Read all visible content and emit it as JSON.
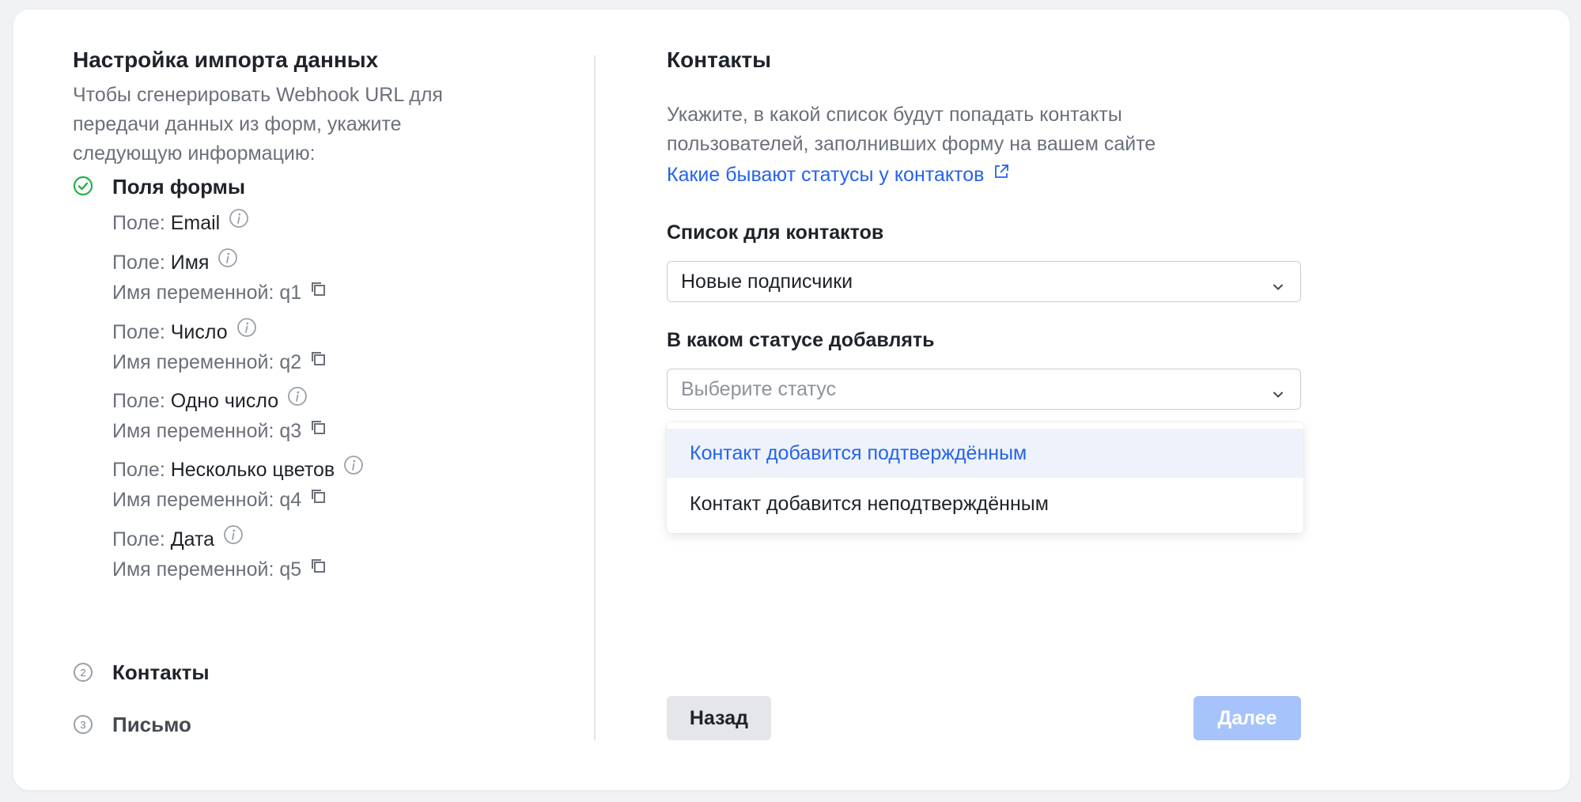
{
  "left": {
    "title": "Настройка импорта данных",
    "description": "Чтобы сгенерировать Webhook URL для передачи данных из форм, укажите следующую информацию:",
    "step1": {
      "title": "Поля формы",
      "fields": [
        {
          "prefix": "Поле:",
          "name": "Email",
          "var_label": "",
          "var": ""
        },
        {
          "prefix": "Поле:",
          "name": "Имя",
          "var_label": "Имя переменной:",
          "var": "q1"
        },
        {
          "prefix": "Поле:",
          "name": "Число",
          "var_label": "Имя переменной:",
          "var": "q2"
        },
        {
          "prefix": "Поле:",
          "name": "Одно число",
          "var_label": "Имя переменной:",
          "var": "q3"
        },
        {
          "prefix": "Поле:",
          "name": "Несколько цветов",
          "var_label": "Имя переменной:",
          "var": "q4"
        },
        {
          "prefix": "Поле:",
          "name": "Дата",
          "var_label": "Имя переменной:",
          "var": "q5"
        }
      ]
    },
    "step2": {
      "number": "2",
      "title": "Контакты"
    },
    "step3": {
      "number": "3",
      "title": "Письмо"
    }
  },
  "right": {
    "title": "Контакты",
    "description": "Укажите, в какой список будут попадать контакты пользователей, заполнивших форму на вашем сайте",
    "link": "Какие бывают статусы у контактов",
    "list_label": "Список для контактов",
    "list_value": "Новые подписчики",
    "status_label": "В каком статусе добавлять",
    "status_placeholder": "Выберите статус",
    "options": [
      "Контакт добавится подтверждённым",
      "Контакт добавится неподтверждённым"
    ],
    "back_label": "Назад",
    "next_label": "Далее"
  },
  "colors": {
    "accent": "#2563eb",
    "success": "#22b14c",
    "next_disabled": "#a7c3fb"
  },
  "icons": [
    "check-circle-icon",
    "info-icon",
    "copy-icon",
    "external-link-icon",
    "chevron-down-icon"
  ]
}
